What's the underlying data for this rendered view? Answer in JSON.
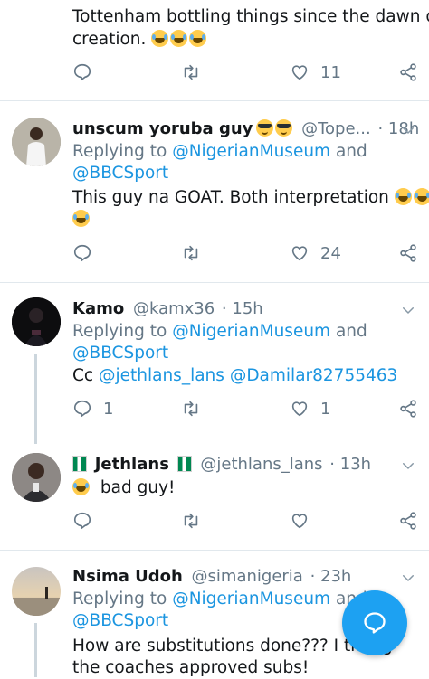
{
  "tweets": [
    {
      "lines": [
        "Tottenham bottling things since the dawn of",
        "creation."
      ],
      "stats": {
        "replies": "",
        "retweets": "",
        "likes": "11"
      }
    },
    {
      "name": "unscum yoruba guy",
      "handle": "@Tope...",
      "time": "· 18h",
      "replying_prefix": "Replying to",
      "mention1": "@NigerianMuseum",
      "and": "and",
      "mention2": "@BBCSport",
      "body": "This guy na GOAT. Both interpretation",
      "stats": {
        "replies": "",
        "retweets": "",
        "likes": "24"
      }
    },
    {
      "name": "Kamo",
      "handle": "@kamx36",
      "time": "· 15h",
      "replying_prefix": "Replying to",
      "mention1": "@NigerianMuseum",
      "and": "and",
      "mention2": "@BBCSport",
      "body_prefix": "Cc",
      "body_mention1": "@jethlans_lans",
      "body_mention2": "@Damilar82755463",
      "stats": {
        "replies": "1",
        "retweets": "",
        "likes": "1"
      }
    },
    {
      "name": "Jethlans",
      "handle": "@jethlans_lans",
      "time": "· 13h",
      "body": "bad guy!",
      "stats": {
        "replies": "",
        "retweets": "",
        "likes": ""
      }
    },
    {
      "name": "Nsima Udoh",
      "handle": "@simanigeria",
      "time": "· 23h",
      "replying_prefix": "Replying to",
      "mention1": "@NigerianMuseum",
      "and": "and",
      "mention2": "@BBCSport",
      "body_line1": "How are substitutions done??? I thoug",
      "body_line2": "the coaches approved subs!"
    }
  ],
  "colors": {
    "accent": "#1da1f2",
    "link": "#1b95e0",
    "muted": "#657786"
  },
  "icons": {
    "reply": "reply-icon",
    "retweet": "retweet-icon",
    "like": "heart-icon",
    "share": "share-icon",
    "compose": "compose-reply-icon"
  }
}
